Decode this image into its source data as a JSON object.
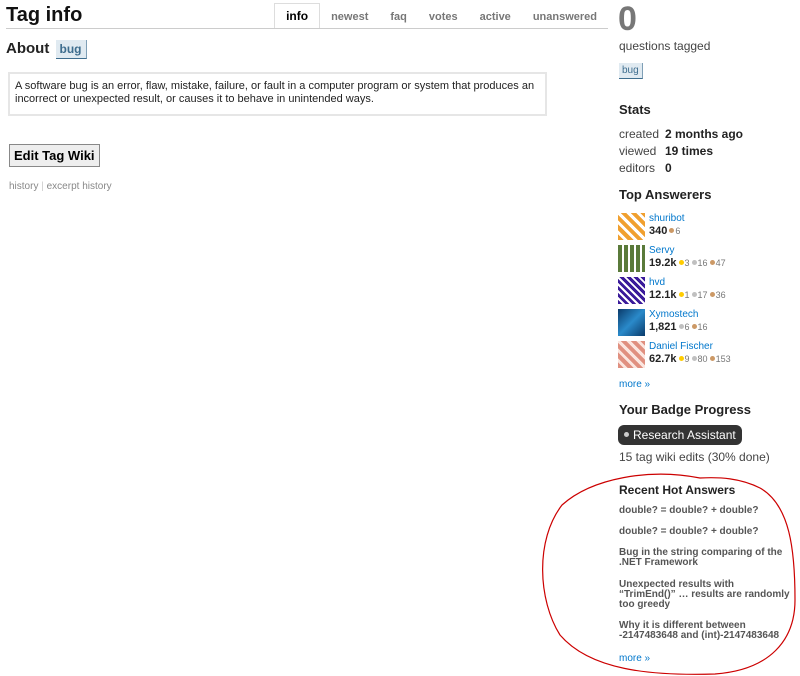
{
  "header": {
    "title": "Tag info",
    "tabs": [
      {
        "label": "info",
        "active": true
      },
      {
        "label": "newest",
        "active": false
      },
      {
        "label": "faq",
        "active": false
      },
      {
        "label": "votes",
        "active": false
      },
      {
        "label": "active",
        "active": false
      },
      {
        "label": "unanswered",
        "active": false
      }
    ]
  },
  "about": {
    "label": "About",
    "tag": "bug"
  },
  "wiki": {
    "text": "A software bug is an error, flaw, mistake, failure, or fault in a computer program or system that produces an incorrect or unexpected result, or causes it to behave in unintended ways."
  },
  "actions": {
    "edit_label": "Edit Tag Wiki",
    "history": "history",
    "excerpt_history": "excerpt history"
  },
  "sidebar": {
    "count": "0",
    "questions_tagged": "questions tagged",
    "tag": "bug",
    "stats": {
      "heading": "Stats",
      "rows": [
        {
          "k": "created",
          "v": "2 months ago"
        },
        {
          "k": "viewed",
          "v": "19 times"
        },
        {
          "k": "editors",
          "v": "0"
        }
      ]
    },
    "top_answerers": {
      "heading": "Top Answerers",
      "users": [
        {
          "name": "shuribot",
          "rep": "340",
          "gold": "",
          "silver": "",
          "bronze": "6",
          "avatar_color": "#f0a030"
        },
        {
          "name": "Servy",
          "rep": "19.2k",
          "gold": "3",
          "silver": "16",
          "bronze": "47",
          "avatar_color": "#5a7a3a"
        },
        {
          "name": "hvd",
          "rep": "12.1k",
          "gold": "1",
          "silver": "17",
          "bronze": "36",
          "avatar_color": "#3a1a9a"
        },
        {
          "name": "Xymostech",
          "rep": "1,821",
          "gold": "",
          "silver": "6",
          "bronze": "16",
          "avatar_color": "#1a5a8a"
        },
        {
          "name": "Daniel Fischer",
          "rep": "62.7k",
          "gold": "9",
          "silver": "80",
          "bronze": "153",
          "avatar_color": "#e09080"
        }
      ],
      "more": "more »"
    },
    "badge_progress": {
      "heading": "Your Badge Progress",
      "badge": "Research Assistant",
      "progress": "15 tag wiki edits (30% done)"
    },
    "hot_answers": {
      "heading": "Recent Hot Answers",
      "items": [
        "double? = double? + double?",
        "double? = double? + double?",
        "Bug in the string comparing of the .NET Framework",
        "Unexpected results with “TrimEnd()” … results are randomly too greedy",
        "Why it is different between -2147483648 and (int)-2147483648"
      ],
      "more": "more »"
    }
  },
  "colors": {
    "link": "#0077cc",
    "annotation": "#cc0000"
  }
}
